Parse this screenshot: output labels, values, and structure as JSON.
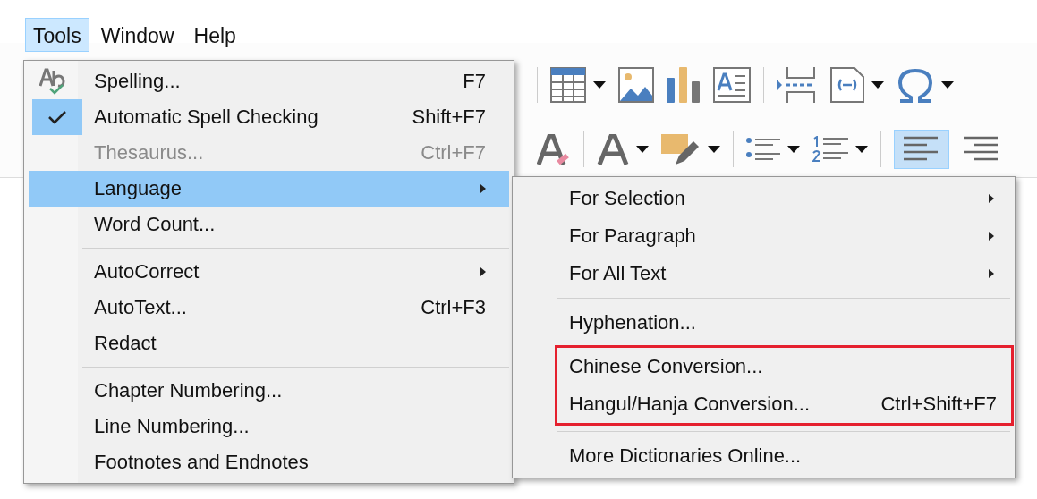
{
  "menubar": [
    {
      "label": "Tools",
      "selected": true
    },
    {
      "label": "Window",
      "selected": false
    },
    {
      "label": "Help",
      "selected": false
    }
  ],
  "toolbar": {
    "align_left": {
      "selected": true
    }
  },
  "tools_menu": {
    "sections": [
      {
        "items": [
          {
            "kind": "spelling",
            "label": "Spelling...",
            "shortcut": "F7",
            "disabled": false,
            "selected": false,
            "submenu": false
          },
          {
            "kind": "check",
            "checked": true,
            "label": "Automatic Spell Checking",
            "shortcut": "Shift+F7",
            "disabled": false,
            "selected": false,
            "submenu": false
          },
          {
            "kind": "plain",
            "label": "Thesaurus...",
            "shortcut": "Ctrl+F7",
            "disabled": true,
            "selected": false,
            "submenu": false
          },
          {
            "kind": "plain",
            "label": "Language",
            "disabled": false,
            "selected": true,
            "submenu": true
          },
          {
            "kind": "plain",
            "label": "Word Count...",
            "disabled": false,
            "selected": false,
            "submenu": false
          }
        ]
      },
      {
        "items": [
          {
            "kind": "plain",
            "label": "AutoCorrect",
            "disabled": false,
            "selected": false,
            "submenu": true
          },
          {
            "kind": "plain",
            "label": "AutoText...",
            "shortcut": "Ctrl+F3",
            "disabled": false,
            "selected": false,
            "submenu": false
          },
          {
            "kind": "plain",
            "label": "Redact",
            "disabled": false,
            "selected": false,
            "submenu": false
          }
        ]
      },
      {
        "items": [
          {
            "kind": "plain",
            "label": "Chapter Numbering...",
            "disabled": false,
            "selected": false,
            "submenu": false
          },
          {
            "kind": "plain",
            "label": "Line Numbering...",
            "disabled": false,
            "selected": false,
            "submenu": false
          },
          {
            "kind": "plain",
            "label": "Footnotes and Endnotes",
            "disabled": false,
            "selected": false,
            "submenu": false
          }
        ]
      }
    ]
  },
  "language_submenu": {
    "sections": [
      {
        "items": [
          {
            "label": "For Selection",
            "submenu": true,
            "outlined": false
          },
          {
            "label": "For Paragraph",
            "submenu": true,
            "outlined": false
          },
          {
            "label": "For All Text",
            "submenu": true,
            "outlined": false
          }
        ]
      },
      {
        "items": [
          {
            "label": "Hyphenation...",
            "submenu": false,
            "outlined": false
          },
          {
            "label": "Chinese Conversion...",
            "submenu": false,
            "outlined": true
          },
          {
            "label": "Hangul/Hanja Conversion...",
            "shortcut": "Ctrl+Shift+F7",
            "submenu": false,
            "outlined": true
          }
        ]
      },
      {
        "items": [
          {
            "label": "More Dictionaries Online...",
            "submenu": false,
            "outlined": false
          }
        ]
      }
    ]
  }
}
